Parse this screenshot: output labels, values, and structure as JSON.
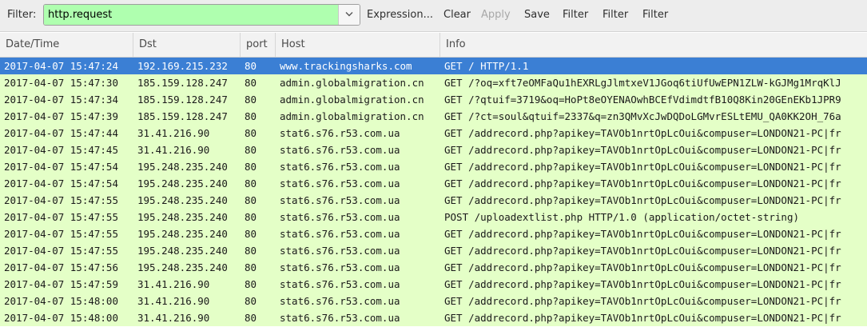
{
  "filter_bar": {
    "label": "Filter:",
    "value": "http.request",
    "buttons": {
      "expression": "Expression...",
      "clear": "Clear",
      "apply": "Apply",
      "save": "Save",
      "filter1": "Filter",
      "filter2": "Filter",
      "filter3": "Filter"
    }
  },
  "table": {
    "columns": {
      "time": "Date/Time",
      "dst": "Dst",
      "port": "port",
      "host": "Host",
      "info": "Info"
    },
    "rows": [
      {
        "time": "2017-04-07 15:47:24",
        "dst": "192.169.215.232",
        "port": "80",
        "host": "www.trackingsharks.com",
        "info": "GET / HTTP/1.1",
        "selected": true
      },
      {
        "time": "2017-04-07 15:47:30",
        "dst": "185.159.128.247",
        "port": "80",
        "host": "admin.globalmigration.cn",
        "info": "GET /?oq=xft7eOMFaQu1hEXRLgJlmtxeV1JGoq6tiUfUwEPN1ZLW-kGJMg1MrqKlJ"
      },
      {
        "time": "2017-04-07 15:47:34",
        "dst": "185.159.128.247",
        "port": "80",
        "host": "admin.globalmigration.cn",
        "info": "GET /?qtuif=3719&oq=HoPt8eOYENAOwhBCEfVdimdtfB10Q8Kin20GEnEKb1JPR9"
      },
      {
        "time": "2017-04-07 15:47:39",
        "dst": "185.159.128.247",
        "port": "80",
        "host": "admin.globalmigration.cn",
        "info": "GET /?ct=soul&qtuif=2337&q=zn3QMvXcJwDQDoLGMvrESLtEMU_QA0KK2OH_76a"
      },
      {
        "time": "2017-04-07 15:47:44",
        "dst": "31.41.216.90",
        "port": "80",
        "host": "stat6.s76.r53.com.ua",
        "info": "GET /addrecord.php?apikey=TAVOb1nrtOpLcOui&compuser=LONDON21-PC|fr"
      },
      {
        "time": "2017-04-07 15:47:45",
        "dst": "31.41.216.90",
        "port": "80",
        "host": "stat6.s76.r53.com.ua",
        "info": "GET /addrecord.php?apikey=TAVOb1nrtOpLcOui&compuser=LONDON21-PC|fr"
      },
      {
        "time": "2017-04-07 15:47:54",
        "dst": "195.248.235.240",
        "port": "80",
        "host": "stat6.s76.r53.com.ua",
        "info": "GET /addrecord.php?apikey=TAVOb1nrtOpLcOui&compuser=LONDON21-PC|fr"
      },
      {
        "time": "2017-04-07 15:47:54",
        "dst": "195.248.235.240",
        "port": "80",
        "host": "stat6.s76.r53.com.ua",
        "info": "GET /addrecord.php?apikey=TAVOb1nrtOpLcOui&compuser=LONDON21-PC|fr"
      },
      {
        "time": "2017-04-07 15:47:55",
        "dst": "195.248.235.240",
        "port": "80",
        "host": "stat6.s76.r53.com.ua",
        "info": "GET /addrecord.php?apikey=TAVOb1nrtOpLcOui&compuser=LONDON21-PC|fr"
      },
      {
        "time": "2017-04-07 15:47:55",
        "dst": "195.248.235.240",
        "port": "80",
        "host": "stat6.s76.r53.com.ua",
        "info": "POST /uploadextlist.php HTTP/1.0  (application/octet-string)"
      },
      {
        "time": "2017-04-07 15:47:55",
        "dst": "195.248.235.240",
        "port": "80",
        "host": "stat6.s76.r53.com.ua",
        "info": "GET /addrecord.php?apikey=TAVOb1nrtOpLcOui&compuser=LONDON21-PC|fr"
      },
      {
        "time": "2017-04-07 15:47:55",
        "dst": "195.248.235.240",
        "port": "80",
        "host": "stat6.s76.r53.com.ua",
        "info": "GET /addrecord.php?apikey=TAVOb1nrtOpLcOui&compuser=LONDON21-PC|fr"
      },
      {
        "time": "2017-04-07 15:47:56",
        "dst": "195.248.235.240",
        "port": "80",
        "host": "stat6.s76.r53.com.ua",
        "info": "GET /addrecord.php?apikey=TAVOb1nrtOpLcOui&compuser=LONDON21-PC|fr"
      },
      {
        "time": "2017-04-07 15:47:59",
        "dst": "31.41.216.90",
        "port": "80",
        "host": "stat6.s76.r53.com.ua",
        "info": "GET /addrecord.php?apikey=TAVOb1nrtOpLcOui&compuser=LONDON21-PC|fr"
      },
      {
        "time": "2017-04-07 15:48:00",
        "dst": "31.41.216.90",
        "port": "80",
        "host": "stat6.s76.r53.com.ua",
        "info": "GET /addrecord.php?apikey=TAVOb1nrtOpLcOui&compuser=LONDON21-PC|fr"
      },
      {
        "time": "2017-04-07 15:48:00",
        "dst": "31.41.216.90",
        "port": "80",
        "host": "stat6.s76.r53.com.ua",
        "info": "GET /addrecord.php?apikey=TAVOb1nrtOpLcOui&compuser=LONDON21-PC|fr"
      }
    ]
  },
  "colors": {
    "filter_valid": "#afffaf",
    "row_http": "#e4ffc7",
    "row_selected": "#3b7fd4"
  }
}
